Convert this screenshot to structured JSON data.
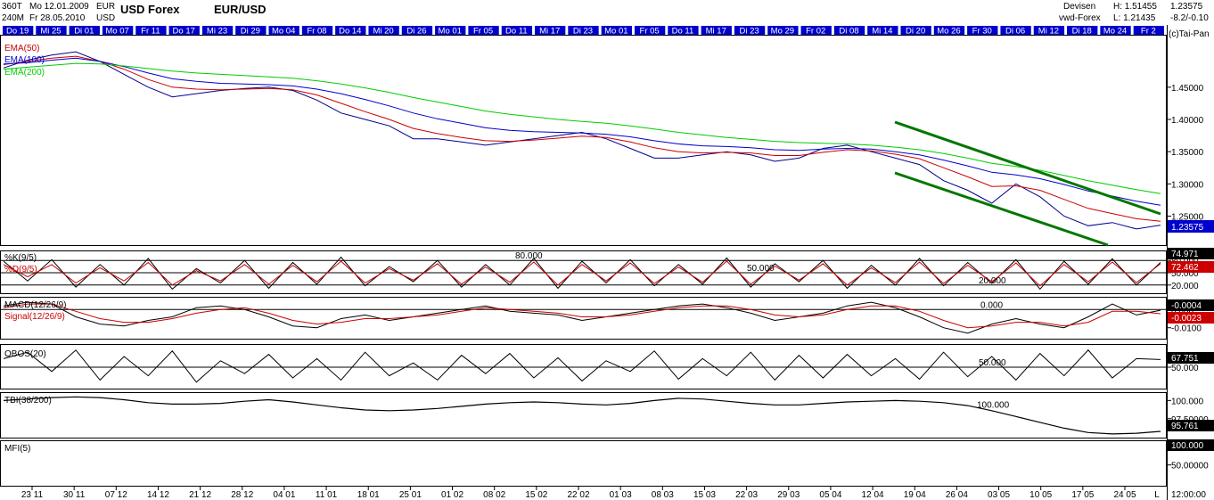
{
  "header": {
    "period": "360T",
    "bars": "240M",
    "date_start": "Mo 12.01.2009",
    "date_end": "Fr 28.05.2010",
    "ccy1": "EUR",
    "ccy2": "USD",
    "market": "USD Forex",
    "symbol": "EUR/USD",
    "source1": "Devisen",
    "source2": "vwd-Forex",
    "high_label": "H: 1.51455",
    "low_label": "L: 1.21435",
    "last_price": "1.23575",
    "change": "-8.2/-0.10",
    "copyright": "(c)Tai-Pan"
  },
  "date_bar": [
    "Do 19",
    "Mi 25",
    "Di 01",
    "Mo 07",
    "Fr 11",
    "Do 17",
    "Mi 23",
    "Di 29",
    "Mo 04",
    "Fr 08",
    "Do 14",
    "Mi 20",
    "Di 26",
    "Mo 01",
    "Fr 05",
    "Do 11",
    "Mi 17",
    "Di 23",
    "Mo 01",
    "Fr 05",
    "Do 11",
    "Mi 17",
    "Di 23",
    "Mo 29",
    "Fr 02",
    "Di 08",
    "Mi 14",
    "Di 20",
    "Mo 26",
    "Fr 30",
    "Di 06",
    "Mi 12",
    "Di 18",
    "Mo 24",
    "Fr 2"
  ],
  "x_axis_labels": [
    "23 11",
    "30 11",
    "07 12",
    "14 12",
    "21 12",
    "28 12",
    "04 01",
    "11 01",
    "18 01",
    "25 01",
    "01 02",
    "08 02",
    "15 02",
    "22 02",
    "01 03",
    "08 03",
    "15 03",
    "22 03",
    "29 03",
    "05 04",
    "12 04",
    "19 04",
    "26 04",
    "03 05",
    "10 05",
    "17 05",
    "24 05",
    "L",
    "12:00:00"
  ],
  "colors": {
    "date_bar_bg": "#0000cc",
    "date_bar_text": "#ffffff",
    "price": "#00008b",
    "ema50": "#cc0000",
    "ema100": "#0000cc",
    "ema200": "#00cc00",
    "trend_channel": "#007700",
    "oscillator": "#000000",
    "signal": "#cc0000",
    "price_tag": "#0000cc"
  },
  "chart_data": [
    {
      "type": "line",
      "panel": "price",
      "legend": [
        "EMA(50)",
        "EMA(100)",
        "EMA(200)"
      ],
      "y_ticks": [
        "1.45000",
        "1.40000",
        "1.35000",
        "1.30000",
        "1.25000"
      ],
      "ylim": [
        1.205,
        1.53
      ],
      "last_value_label": "1.23575",
      "series": [
        {
          "name": "",
          "values": [
            1.48,
            1.492,
            1.5,
            1.505,
            1.49,
            1.47,
            1.45,
            1.435,
            1.44,
            1.445,
            1.448,
            1.45,
            1.445,
            1.43,
            1.41,
            1.4,
            1.39,
            1.37,
            1.37,
            1.365,
            1.36,
            1.365,
            1.37,
            1.375,
            1.38,
            1.37,
            1.355,
            1.34,
            1.34,
            1.345,
            1.35,
            1.345,
            1.335,
            1.34,
            1.355,
            1.36,
            1.35,
            1.34,
            1.33,
            1.305,
            1.29,
            1.27,
            1.3,
            1.28,
            1.25,
            1.235,
            1.24,
            1.23,
            1.236
          ]
        },
        {
          "name": "EMA(50)",
          "values": [
            1.485,
            1.49,
            1.495,
            1.498,
            1.49,
            1.478,
            1.462,
            1.45,
            1.447,
            1.446,
            1.447,
            1.448,
            1.446,
            1.438,
            1.425,
            1.412,
            1.4,
            1.386,
            1.378,
            1.372,
            1.367,
            1.366,
            1.368,
            1.371,
            1.374,
            1.372,
            1.365,
            1.356,
            1.35,
            1.348,
            1.349,
            1.348,
            1.344,
            1.344,
            1.349,
            1.353,
            1.351,
            1.346,
            1.339,
            1.325,
            1.311,
            1.296,
            1.297,
            1.29,
            1.276,
            1.262,
            1.254,
            1.246,
            1.242
          ]
        },
        {
          "name": "EMA(100)",
          "values": [
            1.486,
            1.488,
            1.492,
            1.495,
            1.49,
            1.482,
            1.472,
            1.463,
            1.459,
            1.456,
            1.455,
            1.454,
            1.452,
            1.447,
            1.44,
            1.431,
            1.421,
            1.41,
            1.401,
            1.394,
            1.387,
            1.383,
            1.381,
            1.38,
            1.379,
            1.377,
            1.373,
            1.367,
            1.362,
            1.359,
            1.358,
            1.356,
            1.353,
            1.352,
            1.354,
            1.355,
            1.354,
            1.35,
            1.345,
            1.337,
            1.328,
            1.318,
            1.314,
            1.308,
            1.299,
            1.289,
            1.281,
            1.273,
            1.267
          ]
        },
        {
          "name": "EMA(200)",
          "values": [
            1.478,
            1.481,
            1.484,
            1.487,
            1.486,
            1.483,
            1.479,
            1.475,
            1.472,
            1.47,
            1.468,
            1.466,
            1.464,
            1.46,
            1.455,
            1.449,
            1.442,
            1.434,
            1.427,
            1.42,
            1.413,
            1.408,
            1.404,
            1.4,
            1.397,
            1.394,
            1.39,
            1.385,
            1.38,
            1.376,
            1.372,
            1.369,
            1.366,
            1.364,
            1.363,
            1.362,
            1.36,
            1.357,
            1.353,
            1.347,
            1.34,
            1.332,
            1.327,
            1.321,
            1.313,
            1.305,
            1.298,
            1.291,
            1.285
          ]
        }
      ]
    },
    {
      "type": "line",
      "panel": "stochastic",
      "legend": [
        "%K(9/5)",
        "%D(9/5)"
      ],
      "y_ticks": [
        "80.000",
        "50.000",
        "20.000"
      ],
      "ylim": [
        0,
        100
      ],
      "last_value_labels": [
        "74.971",
        "72.462"
      ],
      "series": [
        {
          "name": "%K(9/5)",
          "values": [
            78,
            30,
            82,
            15,
            70,
            20,
            85,
            10,
            60,
            25,
            80,
            12,
            75,
            22,
            88,
            18,
            65,
            28,
            80,
            15,
            70,
            20,
            85,
            12,
            78,
            25,
            82,
            18,
            70,
            22,
            86,
            15,
            72,
            28,
            80,
            12,
            68,
            20,
            85,
            18,
            75,
            24,
            82,
            10,
            78,
            22,
            84,
            20,
            75
          ]
        },
        {
          "name": "%D(9/5)",
          "values": [
            70,
            40,
            70,
            25,
            62,
            30,
            75,
            20,
            55,
            30,
            70,
            22,
            68,
            28,
            78,
            25,
            60,
            32,
            72,
            22,
            64,
            27,
            76,
            20,
            70,
            30,
            74,
            24,
            64,
            27,
            78,
            22,
            66,
            32,
            72,
            20,
            62,
            26,
            76,
            24,
            68,
            28,
            74,
            18,
            70,
            28,
            76,
            26,
            72
          ]
        }
      ]
    },
    {
      "type": "line",
      "panel": "macd",
      "legend": [
        "MACD(12/26/9)",
        "Signal(12/26/9)"
      ],
      "y_ticks": [
        "0.000",
        "-0.0100"
      ],
      "ylim": [
        -0.016,
        0.006
      ],
      "last_value_labels": [
        "-0.0004",
        "-0.0023"
      ],
      "series": [
        {
          "name": "MACD(12/26/9)",
          "values": [
            0.002,
            0.004,
            0.003,
            -0.004,
            -0.008,
            -0.009,
            -0.006,
            -0.004,
            0.001,
            0.002,
            0.0,
            -0.004,
            -0.009,
            -0.01,
            -0.005,
            -0.003,
            -0.006,
            -0.004,
            -0.002,
            0.0,
            0.002,
            -0.001,
            -0.002,
            -0.003,
            -0.006,
            -0.004,
            -0.002,
            0.0,
            0.002,
            0.003,
            0.001,
            -0.002,
            -0.006,
            -0.004,
            -0.002,
            0.002,
            0.004,
            0.001,
            -0.004,
            -0.01,
            -0.013,
            -0.008,
            -0.005,
            -0.008,
            -0.01,
            -0.004,
            0.003,
            -0.003,
            -0.0004
          ]
        },
        {
          "name": "Signal(12/26/9)",
          "values": [
            0.001,
            0.003,
            0.003,
            -0.001,
            -0.005,
            -0.007,
            -0.007,
            -0.005,
            -0.002,
            0.0,
            0.001,
            -0.002,
            -0.006,
            -0.008,
            -0.007,
            -0.005,
            -0.005,
            -0.004,
            -0.003,
            -0.001,
            0.001,
            0.0,
            -0.001,
            -0.002,
            -0.004,
            -0.004,
            -0.003,
            -0.001,
            0.001,
            0.002,
            0.002,
            0.0,
            -0.003,
            -0.004,
            -0.003,
            0.0,
            0.002,
            0.002,
            -0.001,
            -0.006,
            -0.01,
            -0.009,
            -0.007,
            -0.007,
            -0.009,
            -0.007,
            -0.001,
            -0.001,
            -0.0023
          ]
        }
      ]
    },
    {
      "type": "line",
      "panel": "obos",
      "legend": [
        "OBOS(20)"
      ],
      "y_ticks": [
        "50.000"
      ],
      "ylim": [
        0,
        100
      ],
      "last_value_label": "67.751",
      "series": [
        {
          "name": "OBOS(20)",
          "values": [
            70,
            85,
            40,
            90,
            20,
            75,
            30,
            88,
            15,
            65,
            35,
            80,
            25,
            70,
            20,
            85,
            30,
            60,
            20,
            78,
            35,
            82,
            25,
            72,
            18,
            65,
            40,
            88,
            22,
            70,
            30,
            85,
            20,
            78,
            25,
            80,
            30,
            70,
            22,
            85,
            28,
            75,
            20,
            82,
            30,
            90,
            25,
            70,
            68
          ]
        }
      ]
    },
    {
      "type": "line",
      "panel": "tbi",
      "legend": [
        "TBI(38/200)"
      ],
      "y_ticks": [
        "100.000",
        "97.50000"
      ],
      "ylim": [
        94.9,
        100.9
      ],
      "last_value_label": "95.761",
      "series": [
        {
          "name": "TBI(38/200)",
          "values": [
            100.0,
            100.2,
            100.4,
            100.5,
            100.4,
            100.1,
            99.7,
            99.5,
            99.5,
            99.6,
            99.9,
            100.1,
            99.8,
            99.4,
            99.0,
            98.7,
            98.6,
            98.7,
            98.9,
            99.2,
            99.5,
            99.7,
            99.8,
            99.7,
            99.5,
            99.4,
            99.6,
            100.0,
            100.3,
            100.2,
            99.9,
            99.6,
            99.4,
            99.4,
            99.6,
            99.8,
            99.9,
            100.0,
            99.9,
            99.7,
            99.3,
            98.6,
            97.8,
            97.0,
            96.2,
            95.6,
            95.4,
            95.5,
            95.76
          ]
        }
      ]
    },
    {
      "type": "line",
      "panel": "mfi",
      "legend": [
        "MFI(5)"
      ],
      "y_ticks": [
        "100.000",
        "50.00000"
      ],
      "ylim": [
        0,
        105
      ],
      "last_value_label": "100.000",
      "series": []
    }
  ]
}
